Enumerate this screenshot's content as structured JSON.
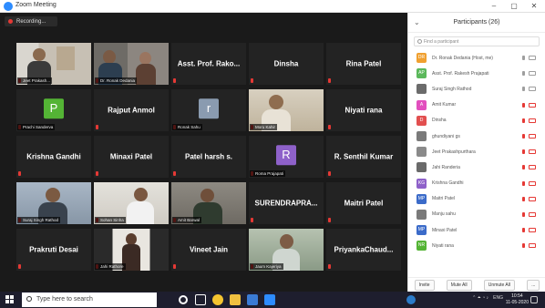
{
  "window": {
    "title": "Zoom Meeting",
    "controls": [
      "–",
      "▢",
      "✕"
    ]
  },
  "recording": {
    "label": "Recording..."
  },
  "tiles": [
    {
      "label": "Jeet Prakash..."
    },
    {
      "label": "Dr. Ronak Dedania"
    },
    {
      "name": "Asst. Prof. Rako..."
    },
    {
      "name": "Dinsha"
    },
    {
      "name": "Rina Patel"
    },
    {
      "avatar": "P",
      "avatar_color": "#54b435",
      "label": "Prachi Sanderva"
    },
    {
      "name": "Rajput Anmol"
    },
    {
      "avatar": "r",
      "avatar_color": "#8a9bb0",
      "label": "Ronak Sahu"
    },
    {
      "label": "Moru Kahir"
    },
    {
      "name": "Niyati rana"
    },
    {
      "name": "Krishna Gandhi"
    },
    {
      "name": "Minaxi Patel"
    },
    {
      "name": "Patel harsh s."
    },
    {
      "avatar": "R",
      "avatar_color": "#8e61c9",
      "label": "Roma Prajapati"
    },
    {
      "name": "R. Senthil Kumar"
    },
    {
      "label": "Suraj Singh Rathod"
    },
    {
      "label": "Sohan Sinha"
    },
    {
      "label": "Amit Barwal"
    },
    {
      "name": "SURENDRAPRA..."
    },
    {
      "name": "Maitri Patel"
    },
    {
      "name": "Prakruti Desai"
    },
    {
      "label": "Jahi Rathore"
    },
    {
      "name": "Vineet Jain"
    },
    {
      "label": "Jaum Kajeriya"
    },
    {
      "name": "PriyankaChaud..."
    }
  ],
  "participants_panel": {
    "title": "Participants (26)",
    "search_placeholder": "Find a participant",
    "items": [
      {
        "initials": "DR",
        "color": "#f0a030",
        "name": "Dr. Ronak Dedania (Host, me)",
        "mic": "on",
        "cam": "on"
      },
      {
        "initials": "AP",
        "color": "#5bb85b",
        "name": "Asst. Prof. Rakesh Prajapati",
        "mic": "on",
        "cam": "on"
      },
      {
        "initials": "",
        "color": "#6b6b6b",
        "name": "Suraj Singh Rathod",
        "mic": "on",
        "cam": "on"
      },
      {
        "initials": "A",
        "color": "#e24fbe",
        "name": "Amit Kumar",
        "mic": "off",
        "cam": "off"
      },
      {
        "initials": "D",
        "color": "#e24f4f",
        "name": "Dinsha",
        "mic": "off",
        "cam": "off"
      },
      {
        "initials": "",
        "color": "#7a7a7a",
        "name": "ghundiyani gs",
        "mic": "off",
        "cam": "off"
      },
      {
        "initials": "",
        "color": "#8a8a8a",
        "name": "Jeet Prakashpurthara",
        "mic": "off",
        "cam": "off"
      },
      {
        "initials": "",
        "color": "#6a6a6a",
        "name": "Jahi Randeria",
        "mic": "off",
        "cam": "off"
      },
      {
        "initials": "KG",
        "color": "#8e61c9",
        "name": "Krishna Gandhi",
        "mic": "off",
        "cam": "off"
      },
      {
        "initials": "MP",
        "color": "#3b6bc9",
        "name": "Maitri Patel",
        "mic": "off",
        "cam": "off"
      },
      {
        "initials": "",
        "color": "#7a7a7a",
        "name": "Manju sahu",
        "mic": "off",
        "cam": "off"
      },
      {
        "initials": "MP",
        "color": "#3b6bc9",
        "name": "Minaxi Patel",
        "mic": "off",
        "cam": "off"
      },
      {
        "initials": "NR",
        "color": "#54b435",
        "name": "Niyati rana",
        "mic": "off",
        "cam": "off"
      }
    ],
    "buttons": {
      "invite": "Invite",
      "mute_all": "Mute All",
      "unmute_all": "Unmute All",
      "more": "..."
    }
  },
  "taskbar": {
    "search_placeholder": "Type here to search",
    "clock_time": "10:54",
    "clock_date": "11-05-2020",
    "tray_lang": "ENG"
  }
}
